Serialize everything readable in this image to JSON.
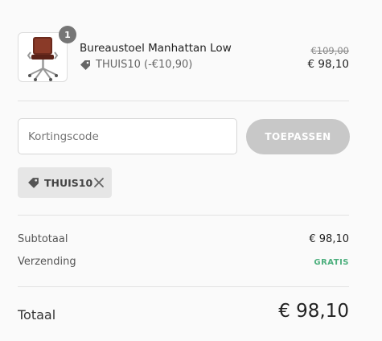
{
  "product": {
    "name": "Bureaustoel Manhattan Low",
    "quantity": "1",
    "discount_text": "THUIS10 (-€10,90)",
    "price_original": "€109,00",
    "price_final": "€ 98,10",
    "thumbnail_icon": "office-chair-image"
  },
  "discount": {
    "placeholder": "Kortingscode",
    "value": "",
    "apply_label": "TOEPASSEN",
    "applied_code": "THUIS10",
    "tag_icon": "tag-icon",
    "remove_icon": "close-icon"
  },
  "totals": {
    "subtotal_label": "Subtotaal",
    "subtotal_value": "€ 98,10",
    "shipping_label": "Verzending",
    "shipping_value": "GRATIS",
    "total_label": "Totaal",
    "total_value": "€ 98,10"
  },
  "colors": {
    "free_shipping": "#4caf7d",
    "apply_button": "#c8c8c8",
    "badge": "#767676"
  }
}
